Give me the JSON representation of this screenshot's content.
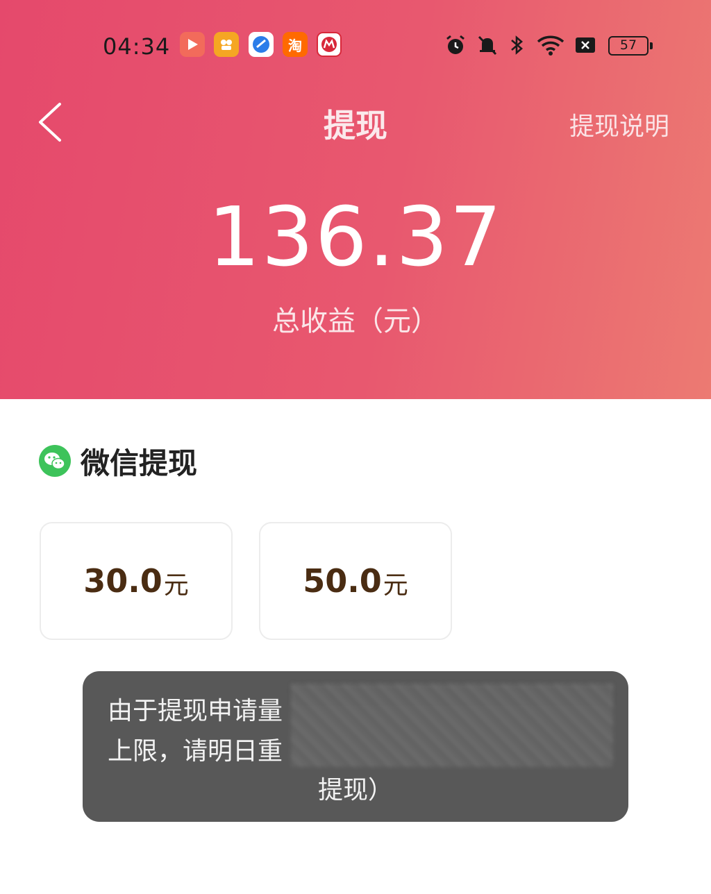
{
  "status_bar": {
    "time": "04:34",
    "apps": [
      {
        "name": "video-app-icon",
        "color": "#f26b5b",
        "glyph": "▶"
      },
      {
        "name": "game-app-icon",
        "color": "#f5a623",
        "glyph": "♘"
      },
      {
        "name": "browser-app-icon",
        "color": "#2b7de9",
        "glyph": "●"
      },
      {
        "name": "taobao-app-icon",
        "color": "#ff6a00",
        "glyph": "淘"
      },
      {
        "name": "bank-app-icon",
        "color": "#d8283a",
        "glyph": "M"
      }
    ],
    "battery": "57"
  },
  "nav": {
    "title": "提现",
    "help_label": "提现说明"
  },
  "balance": {
    "amount": "136.37",
    "label": "总收益（元）"
  },
  "section": {
    "title": "微信提现"
  },
  "options": [
    {
      "value": "30.0",
      "unit": "元"
    },
    {
      "value": "50.0",
      "unit": "元"
    }
  ],
  "toast": {
    "line1": "由于提现申请量",
    "line2": "上限，请明日重",
    "line3": "提现）"
  },
  "colors": {
    "header_start": "#e5496c",
    "header_end": "#ec7a72",
    "amount_text": "#4a2c12",
    "wechat_green": "#3dc35a"
  }
}
